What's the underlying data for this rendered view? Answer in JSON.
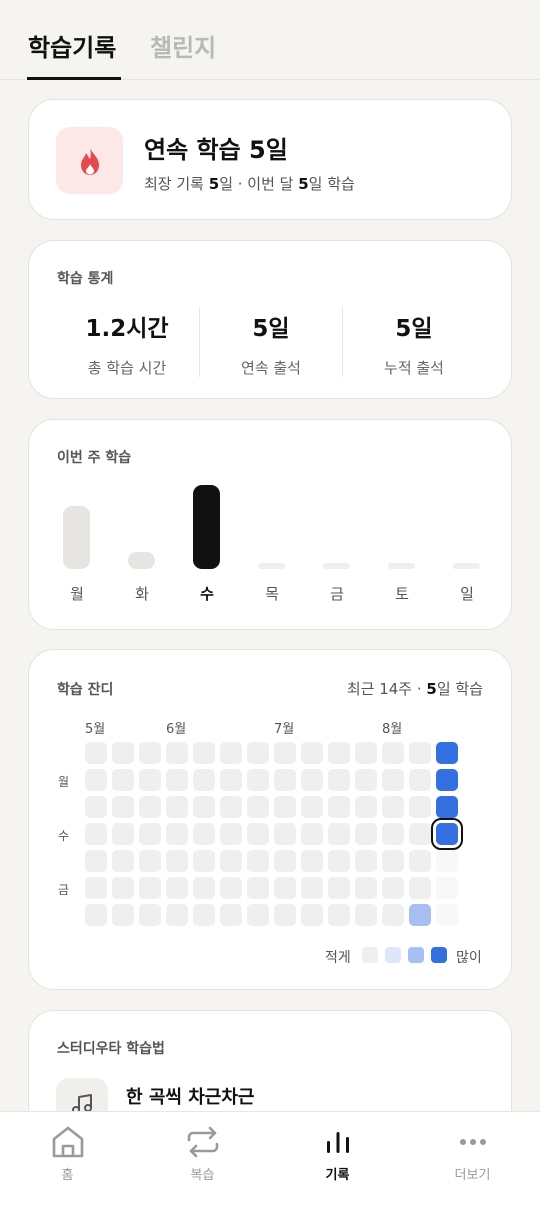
{
  "tabs": [
    {
      "label": "학습기록",
      "active": true
    },
    {
      "label": "챌린지",
      "active": false
    }
  ],
  "streak": {
    "title": "연속 학습 5일",
    "sub_prefix": "최장 기록 ",
    "sub_best": "5",
    "sub_mid": "일 · 이번 달 ",
    "sub_month": "5",
    "sub_suffix": "일 학습",
    "icon": "flame-icon",
    "accent": "#e5484d"
  },
  "stats": {
    "title": "학습 통계",
    "items": [
      {
        "value": "1.2시간",
        "label": "총 학습 시간"
      },
      {
        "value": "5일",
        "label": "연속 출석"
      },
      {
        "value": "5일",
        "label": "누적 출석"
      }
    ]
  },
  "week": {
    "title": "이번 주 학습",
    "days": [
      "월",
      "화",
      "수",
      "목",
      "금",
      "토",
      "일"
    ],
    "levels": [
      0.75,
      0.2,
      1.0,
      0,
      0,
      0,
      0
    ],
    "today_index": 2
  },
  "heatmap": {
    "title": "학습 잔디",
    "summary_prefix": "최근 14주 · ",
    "summary_days": "5",
    "summary_suffix": "일 학습",
    "months": [
      "5월",
      "6월",
      "7월",
      "8월"
    ],
    "row_labels": [
      "월",
      "수",
      "금"
    ],
    "weeks": 14,
    "active_cells": [
      {
        "week": 13,
        "day": 0,
        "level": 4
      },
      {
        "week": 13,
        "day": 1,
        "level": 4
      },
      {
        "week": 13,
        "day": 2,
        "level": 4
      },
      {
        "week": 13,
        "day": 3,
        "level": 4,
        "today": true
      },
      {
        "week": 12,
        "day": 6,
        "level": 2
      }
    ],
    "future_cells": [
      {
        "week": 13,
        "day": 4
      },
      {
        "week": 13,
        "day": 5
      },
      {
        "week": 13,
        "day": 6
      }
    ],
    "legend_less": "적게",
    "legend_more": "많이",
    "colors": [
      "#efefef",
      "#dde6fb",
      "#a7bff3",
      "#3b73e0",
      "#3470df"
    ]
  },
  "method": {
    "title": "스터디우타 학습법",
    "item": "한 곡씩 차근차근",
    "icon": "music-note-icon"
  },
  "nav": [
    {
      "label": "홈",
      "icon": "home-icon",
      "active": false
    },
    {
      "label": "복습",
      "icon": "repeat-icon",
      "active": false
    },
    {
      "label": "기록",
      "icon": "bar-chart-icon",
      "active": true
    },
    {
      "label": "더보기",
      "icon": "more-icon",
      "active": false
    }
  ]
}
